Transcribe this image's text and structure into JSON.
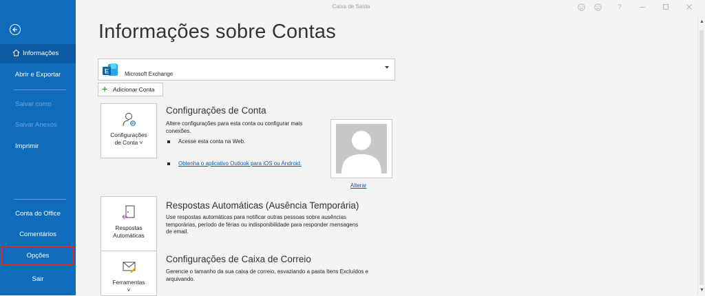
{
  "window": {
    "title": "Caixa de Saída",
    "controls": [
      "smile-icon",
      "frown-icon",
      "help-icon",
      "minimize-icon",
      "maximize-icon",
      "close-icon"
    ]
  },
  "sidebar": {
    "items": [
      {
        "label": "Informações",
        "selected": true
      },
      {
        "label": "Abrir e Exportar"
      },
      {
        "label": "Salvar como",
        "disabled": true
      },
      {
        "label": "Salvar Anexos",
        "disabled": true
      },
      {
        "label": "Imprimir"
      },
      {
        "label": "Conta do Office"
      },
      {
        "label": "Comentários"
      },
      {
        "label": "Opções",
        "highlighted": true
      },
      {
        "label": "Sair"
      }
    ],
    "colors": {
      "background": "#0f6cbd",
      "selected": "#0b5aa3",
      "highlight": "#e8232f"
    }
  },
  "main": {
    "title": "Informações sobre Contas",
    "account": {
      "name": "Microsoft Exchange",
      "icon": "exchange-icon"
    },
    "add_account_label": "Adicionar Conta",
    "sections": {
      "account_settings": {
        "tile_line1": "Configurações",
        "tile_line2": "de Conta ˅",
        "title": "Configurações de Conta",
        "desc_line1": "Altere configurações para esta conta ou configurar mais",
        "desc_line2": "conexões.",
        "bullet1": "Acesse esta conta na Web.",
        "bullet2_link": "Obtenha o aplicativo Outlook para iOS ou Android.",
        "photo_link": "Alterar"
      },
      "auto_replies": {
        "tile_line1": "Respostas",
        "tile_line2": "Automáticas",
        "title": "Respostas Automáticas (Ausência Temporária)",
        "desc_line1": "Use respostas automáticas para notificar outras pessoas sobre ausências",
        "desc_line2": "temporárias, período de férias ou indisponibilidade para responder mensagens",
        "desc_line3": "de email."
      },
      "mailbox_settings": {
        "tile_line1": "Ferramentas",
        "tile_line2": "˅",
        "title": "Configurações de Caixa de Correio",
        "desc_line1": "Gerencie o tamanho da sua caixa de correio, esvaziando a pasta Itens Excluídos e",
        "desc_line2": "arquivando."
      }
    }
  }
}
